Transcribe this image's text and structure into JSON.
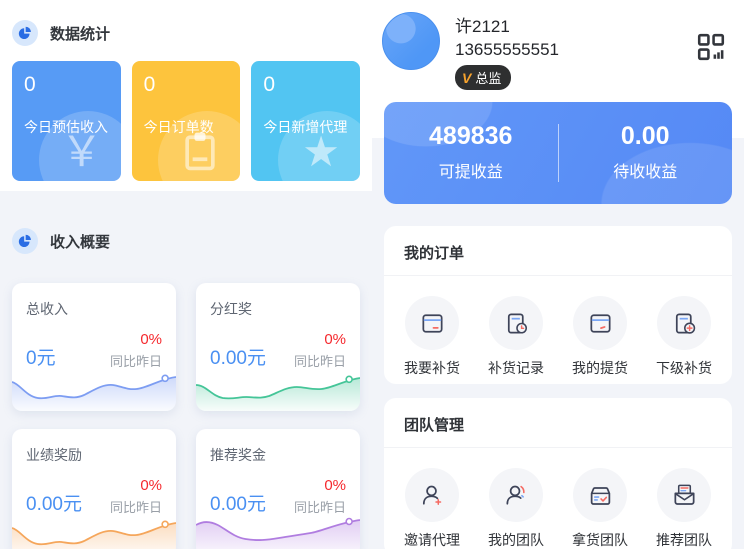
{
  "left": {
    "stats": {
      "title": "数据统计",
      "cards": [
        {
          "value": "0",
          "label": "今日预估收入",
          "bg": "#579bf5",
          "watermark": "yen-icon",
          "glyph": "￥"
        },
        {
          "value": "0",
          "label": "今日订单数",
          "bg": "#fdc43d",
          "watermark": "clipboard-icon",
          "glyph": ""
        },
        {
          "value": "0",
          "label": "今日新增代理",
          "bg": "#52c5f2",
          "watermark": "star-icon",
          "glyph": "★"
        }
      ]
    },
    "income": {
      "title": "收入概要",
      "cards": [
        {
          "title": "总收入",
          "value": "0元",
          "percent": "0%",
          "compare": "同比昨日",
          "line_color": "#7d9df2"
        },
        {
          "title": "分红奖",
          "value": "0.00元",
          "percent": "0%",
          "compare": "同比昨日",
          "line_color": "#45c598"
        },
        {
          "title": "业绩奖励",
          "value": "0.00元",
          "percent": "0%",
          "compare": "同比昨日",
          "line_color": "#f5a65b"
        },
        {
          "title": "推荐奖金",
          "value": "0.00元",
          "percent": "0%",
          "compare": "同比昨日",
          "line_color": "#b07de0"
        }
      ]
    }
  },
  "right": {
    "profile": {
      "name": "许2121",
      "phone": "13655555551",
      "badge_v": "V",
      "badge_role": "总监"
    },
    "earnings": {
      "left_value": "489836",
      "left_label": "可提收益",
      "right_value": "0.00",
      "right_label": "待收收益"
    },
    "orders": {
      "title": "我的订单",
      "items": [
        {
          "label": "我要补货",
          "icon": "restock-icon"
        },
        {
          "label": "补货记录",
          "icon": "restock-record-icon"
        },
        {
          "label": "我的提货",
          "icon": "pickup-icon"
        },
        {
          "label": "下级补货",
          "icon": "sub-restock-icon"
        }
      ]
    },
    "team": {
      "title": "团队管理",
      "items": [
        {
          "label": "邀请代理",
          "icon": "invite-agent-icon"
        },
        {
          "label": "我的团队",
          "icon": "my-team-icon"
        },
        {
          "label": "拿货团队",
          "icon": "goods-team-icon"
        },
        {
          "label": "推荐团队",
          "icon": "referral-team-icon"
        }
      ]
    }
  }
}
